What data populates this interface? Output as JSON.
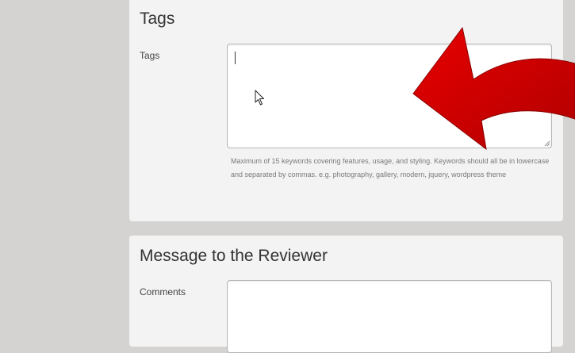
{
  "tags_section": {
    "title": "Tags",
    "field_label": "Tags",
    "textarea_value": "",
    "help_text": "Maximum of 15 keywords covering features, usage, and styling. Keywords should all be in lowercase and separated by commas. e.g. photography, gallery, modern, jquery, wordpress theme"
  },
  "message_section": {
    "title": "Message to the Reviewer",
    "field_label": "Comments",
    "textarea_value": ""
  },
  "icons": {
    "mouse_pointer": "mouse-pointer-icon",
    "overlay_arrow": "red-curved-arrow-icon",
    "resize": "resize-grip-icon"
  },
  "colors": {
    "page_bg": "#d4d3d2",
    "panel_bg": "#f3f3f3",
    "arrow_red": "#d40000"
  }
}
